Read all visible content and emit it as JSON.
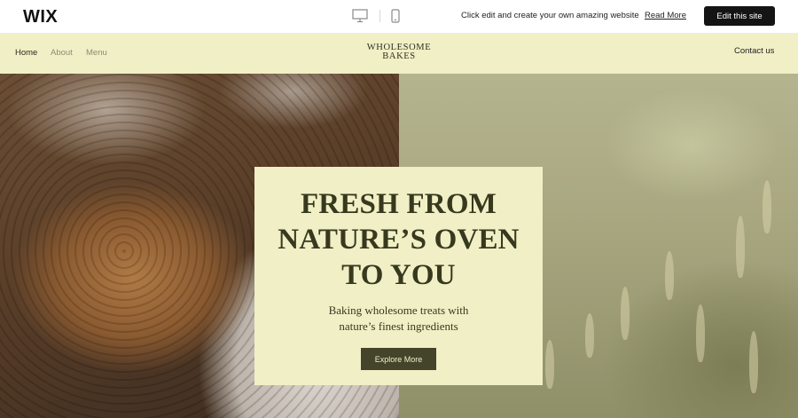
{
  "wix_bar": {
    "logo": "WIX",
    "promo_text": "Click edit and create your own amazing website",
    "read_more": "Read More",
    "edit_button": "Edit this site",
    "devices": [
      "desktop-icon",
      "mobile-icon"
    ]
  },
  "site_header": {
    "nav": [
      "Home",
      "About",
      "Menu"
    ],
    "active_nav": "Home",
    "logo_line1": "WHOLESOME",
    "logo_line2": "BAKES",
    "contact": "Contact us"
  },
  "hero": {
    "title_lines": [
      "FRESH FROM",
      "NATURE’S OVEN",
      "TO YOU"
    ],
    "subtitle_lines": [
      "Baking wholesome treats with",
      "nature’s finest ingredients"
    ],
    "cta": "Explore More"
  },
  "colors": {
    "header_bg": "#f1efc5",
    "card_bg": "#f1efc5",
    "title_text": "#37391f",
    "cta_bg": "#44442b",
    "edit_button_bg": "#141414"
  }
}
